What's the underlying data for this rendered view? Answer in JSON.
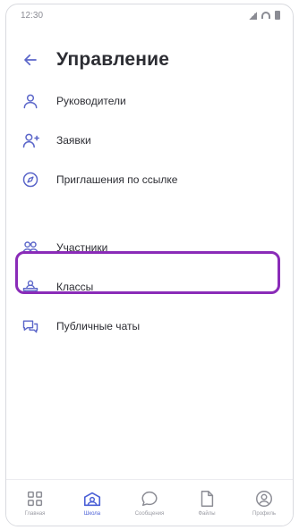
{
  "status_bar": {
    "time": "12:30"
  },
  "header": {
    "title": "Управление"
  },
  "menu": {
    "items": [
      {
        "label": "Руководители",
        "icon": "person-icon"
      },
      {
        "label": "Заявки",
        "icon": "person-add-icon"
      },
      {
        "label": "Приглашения по ссылке",
        "icon": "compass-icon"
      },
      {
        "label": "Участники",
        "icon": "group-icon"
      },
      {
        "label": "Классы",
        "icon": "classes-icon"
      },
      {
        "label": "Публичные чаты",
        "icon": "chats-icon"
      }
    ]
  },
  "bottom_nav": {
    "items": [
      {
        "label": "Главная",
        "icon": "grid-icon",
        "active": false
      },
      {
        "label": "Школа",
        "icon": "school-icon",
        "active": true
      },
      {
        "label": "Сообщения",
        "icon": "chat-icon",
        "active": false
      },
      {
        "label": "Файлы",
        "icon": "file-icon",
        "active": false
      },
      {
        "label": "Профиль",
        "icon": "profile-icon",
        "active": false
      }
    ]
  },
  "colors": {
    "accent_icon": "#5b66c9",
    "highlight_border": "#8a2bb8",
    "text": "#2c2d33",
    "active_nav": "#4a5fd6"
  }
}
